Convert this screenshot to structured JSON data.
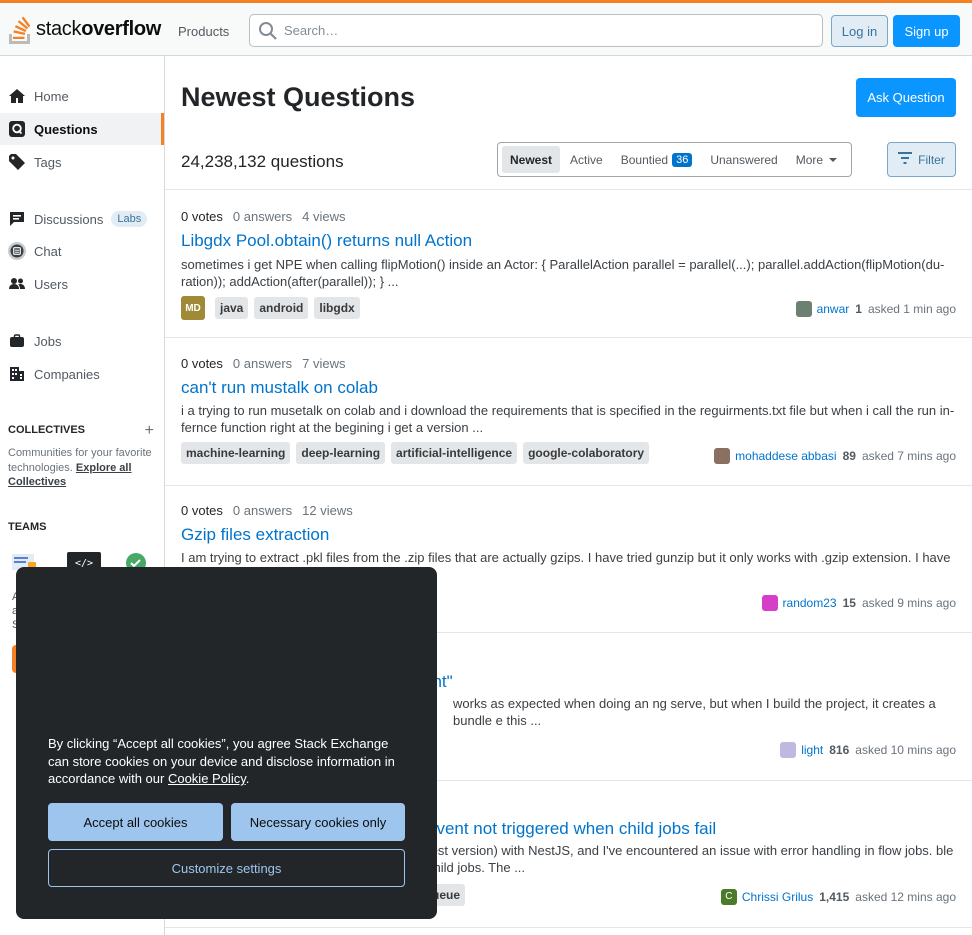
{
  "header": {
    "logo_prefix": "stack",
    "logo_suffix": "overflow",
    "products_label": "Products",
    "search_placeholder": "Search…",
    "login_label": "Log in",
    "signup_label": "Sign up"
  },
  "sidebar": {
    "items": [
      {
        "label": "Home",
        "icon": "home-icon"
      },
      {
        "label": "Questions",
        "icon": "questions-icon",
        "active": true
      },
      {
        "label": "Tags",
        "icon": "tag-icon"
      },
      {
        "label": "Discussions",
        "icon": "discussions-icon",
        "badge": "Labs"
      },
      {
        "label": "Chat",
        "icon": "chat-icon"
      },
      {
        "label": "Users",
        "icon": "users-icon"
      },
      {
        "label": "Jobs",
        "icon": "briefcase-icon"
      },
      {
        "label": "Companies",
        "icon": "building-icon"
      }
    ],
    "collectives_heading": "COLLECTIVES",
    "collectives_desc": "Communities for your favorite technologies.",
    "collectives_link": "Explore all Collectives",
    "teams_heading": "TEAMS",
    "teams_fragments": [
      "A",
      "a",
      "S"
    ]
  },
  "main": {
    "title": "Newest Questions",
    "ask_label": "Ask Question",
    "question_count": "24,238,132 questions",
    "filter_tabs": [
      {
        "label": "Newest",
        "active": true
      },
      {
        "label": "Active"
      },
      {
        "label": "Bountied",
        "badge": "36"
      },
      {
        "label": "Unanswered"
      },
      {
        "label": "More",
        "caret": true
      }
    ],
    "filter_label": "Filter"
  },
  "questions": [
    {
      "votes": "0 votes",
      "answers": "0 answers",
      "views": "4 views",
      "title": "Libgdx Pool.obtain() returns null Action",
      "excerpt": "sometimes i get NPE when calling flipMotion() inside an Actor: { ParallelAction parallel = parallel(...); parallel.addAction(flipMotion(du-ration)); addAction(after(parallel)); } ...",
      "badge": "MD",
      "tags": [
        "java",
        "android",
        "libgdx"
      ],
      "user": "anwar",
      "rep": "1",
      "time": "asked 1 min ago"
    },
    {
      "votes": "0 votes",
      "answers": "0 answers",
      "views": "7 views",
      "title": "can't run mustalk on colab",
      "excerpt": "i a trying to run musetalk on colab and i download the requirements that is specified in the reguirments.txt file but when i call the run in-fernce function right at the begining i get a version ...",
      "tags": [
        "machine-learning",
        "deep-learning",
        "artificial-intelligence",
        "google-colaboratory"
      ],
      "user": "mohaddese abbasi",
      "rep": "89",
      "time": "asked 7 mins ago"
    },
    {
      "votes": "0 votes",
      "answers": "0 answers",
      "views": "12 views",
      "title": "Gzip files extraction",
      "excerpt": "I am trying to extract .pkl files from the .zip files that are actually gzips. I have tried gunzip but it only works with .gzip extension. I have tried ... (pkl,...",
      "tags": [],
      "user": "random23",
      "rep": "15",
      "time": "asked 9 mins ago"
    },
    {
      "votes": "",
      "answers": "",
      "views": "",
      "title": "ent\"",
      "excerpt": "works as expected when doing an ng serve, but when I build the project, it creates a bundle e this ...",
      "tags": [],
      "user": "light",
      "rep": "816",
      "time": "asked 10 mins ago"
    },
    {
      "votes": "",
      "answers": "",
      "views": "",
      "title": "event not triggered when child jobs fail",
      "excerpt": "test version) with NestJS, and I've encountered an issue with error handling in flow jobs. ble child jobs. The ...",
      "tags": [
        "ueue"
      ],
      "user": "Chrissi Grilus",
      "rep": "1,415",
      "time": "asked 12 mins ago"
    }
  ],
  "cookie": {
    "text_before": "By clicking “Accept all cookies”, you agree Stack Exchange can store cookies on your device and disclose information in accordance with our ",
    "policy_link": "Cookie Policy",
    "text_after": ".",
    "accept_label": "Accept all cookies",
    "necessary_label": "Necessary cookies only",
    "customize_label": "Customize settings"
  },
  "colors": {
    "brand_orange": "#f48225",
    "link_blue": "#0074cc",
    "primary_button": "#0a95ff"
  }
}
